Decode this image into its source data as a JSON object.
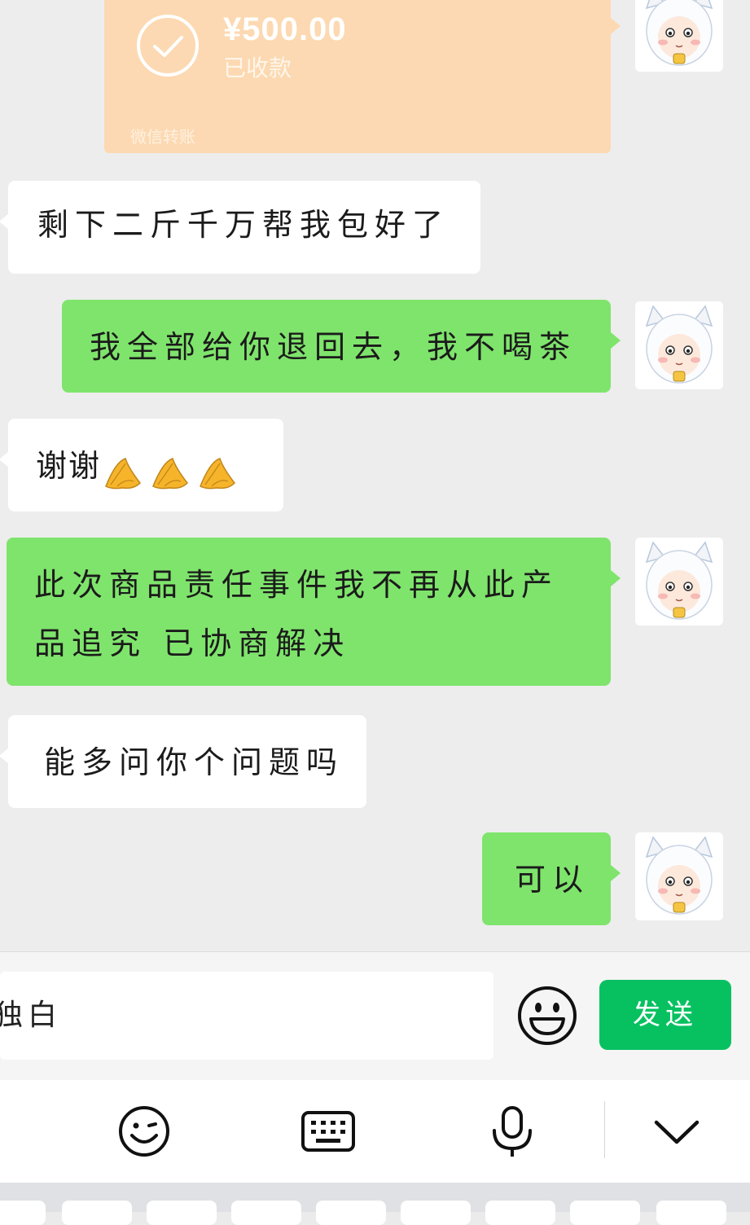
{
  "transfer": {
    "amount": "¥500.00",
    "status": "已收款",
    "footer": "微信转账",
    "color": "#fcd9b2"
  },
  "messages": [
    {
      "side": "left",
      "text": "剩下二斤千万帮我包好了"
    },
    {
      "side": "right",
      "text": "我全部给你退回去，我不喝茶"
    },
    {
      "side": "left",
      "text": "谢谢",
      "emoji": "folded-hands-emoji",
      "emoji_count": 3
    },
    {
      "side": "right",
      "line1": "此次商品责任事件我不再从此产",
      "line2": "品追究 已协商解决"
    },
    {
      "side": "left",
      "text": "能多问你个问题吗"
    },
    {
      "side": "right",
      "text": "可以"
    }
  ],
  "input": {
    "value": "独白",
    "send_label": "发送"
  },
  "colors": {
    "bubble_right": "#7fe46c",
    "bubble_left": "#ffffff",
    "send_button": "#07c160",
    "chat_background": "#ededed"
  },
  "toolbar_icons": [
    "emoji-icon",
    "keyboard-icon",
    "microphone-icon",
    "chevron-down-icon"
  ]
}
